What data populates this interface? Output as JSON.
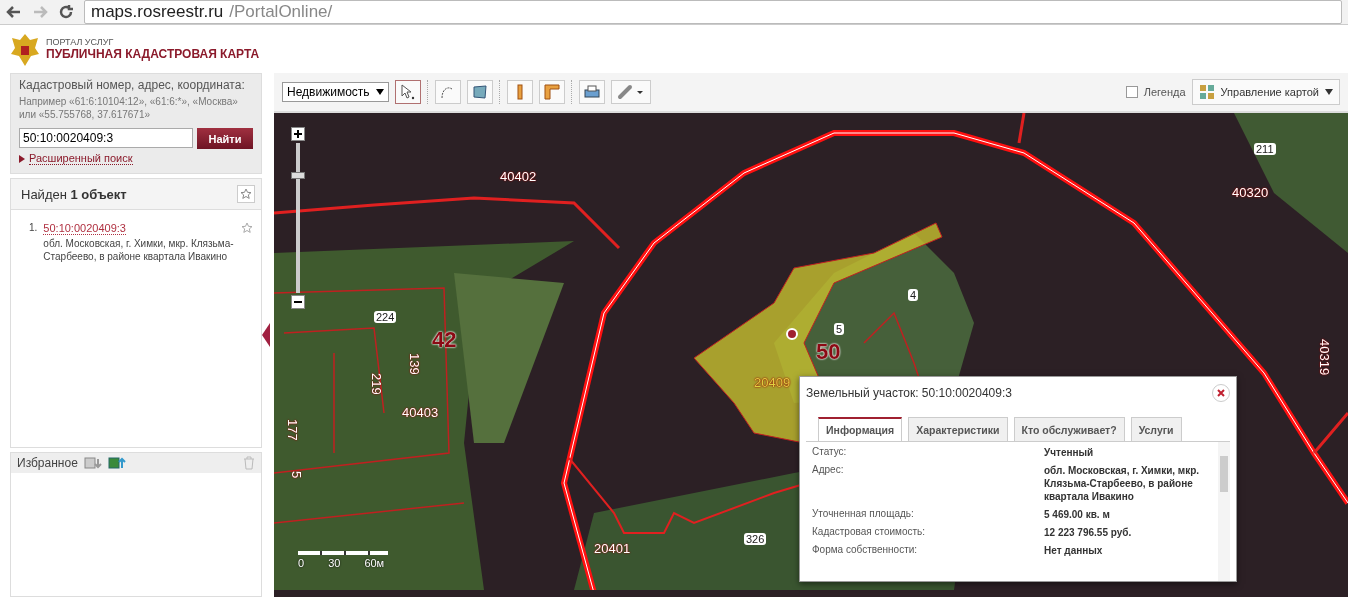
{
  "browser": {
    "url_host": "maps.rosreestr.ru",
    "url_path": "/PortalOnline/"
  },
  "header": {
    "subtitle": "ПОРТАЛ УСЛУГ",
    "title": "ПУБЛИЧНАЯ КАДАСТРОВАЯ КАРТА"
  },
  "search": {
    "label": "Кадастровый номер, адрес, координата:",
    "hint": "Например «61:6:10104:12», «61:6:*», «Москва» или «55.755768, 37.617671»",
    "value": "50:10:0020409:3",
    "button": "Найти",
    "advanced_link": "Расширенный поиск"
  },
  "results": {
    "title": "Найден **1 объект**",
    "items": [
      {
        "number": "1.",
        "id": "50:10:0020409:3",
        "address": "обл. Московская, г. Химки, мкр. Клязьма-Старбеево, в районе квартала Ивакино"
      }
    ]
  },
  "favorites": {
    "title": "Избранное"
  },
  "toolbar": {
    "dropdown": "Недвижимость",
    "legend": {
      "label": "Легенда",
      "checked": false
    },
    "map_control": "Управление картой"
  },
  "zoom": {
    "level": 0.8
  },
  "map_labels": [
    {
      "text": "40402",
      "kind": "quarter"
    },
    {
      "text": "40320",
      "kind": "quarter"
    },
    {
      "text": "40319",
      "kind": "vertical"
    },
    {
      "text": "211",
      "kind": "boxed"
    },
    {
      "text": "4",
      "kind": "boxed"
    },
    {
      "text": "5",
      "kind": "boxed"
    },
    {
      "text": "50",
      "kind": "big"
    },
    {
      "text": "224",
      "kind": "boxed"
    },
    {
      "text": "42",
      "kind": "big"
    },
    {
      "text": "219",
      "kind": "vertical"
    },
    {
      "text": "139",
      "kind": "vertical"
    },
    {
      "text": "40403",
      "kind": "quarter"
    },
    {
      "text": "177",
      "kind": "vertical"
    },
    {
      "text": "5",
      "kind": "vertical"
    },
    {
      "text": "20409",
      "kind": "parcel"
    },
    {
      "text": "20401",
      "kind": "quarter"
    },
    {
      "text": "326",
      "kind": "boxed"
    }
  ],
  "scale": [
    "0",
    "30",
    "60м"
  ],
  "popup": {
    "title": "Земельный участок: 50:10:0020409:3",
    "tabs": [
      {
        "label": "Информация",
        "selected": true
      },
      {
        "label": "Характеристики",
        "selected": false
      },
      {
        "label": "Кто обслуживает?",
        "selected": false
      },
      {
        "label": "Услуги",
        "selected": false
      }
    ],
    "rows": [
      {
        "label": "Статус:",
        "value": "Учтенный"
      },
      {
        "label": "Адрес:",
        "value": "обл. Московская, г. Химки, мкр. Клязьма-Старбеево, в районе квартала Ивакино"
      },
      {
        "label": "Уточненная площадь:",
        "value": "5 469.00 кв. м"
      },
      {
        "label": "Кадастровая стоимость:",
        "value": "12 223 796.55 руб."
      },
      {
        "label": "Форма собственности:",
        "value": "Нет данных"
      }
    ]
  }
}
